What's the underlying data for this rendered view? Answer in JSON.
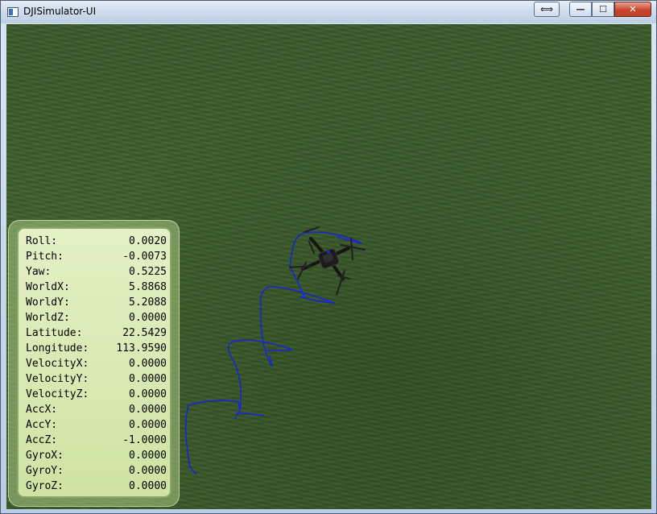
{
  "window": {
    "title": "DJISimulator-UI",
    "buttons": {
      "extra": "⟺",
      "minimize": "—",
      "maximize": "☐",
      "close": "✕"
    }
  },
  "colors": {
    "ground": "#3d5b2d",
    "trajectory": "#1626d6",
    "panel": "#d8eab2"
  },
  "telemetry": [
    {
      "label": "Roll:",
      "value": "0.0020"
    },
    {
      "label": "Pitch:",
      "value": "-0.0073"
    },
    {
      "label": "Yaw:",
      "value": "0.5225"
    },
    {
      "label": "WorldX:",
      "value": "5.8868"
    },
    {
      "label": "WorldY:",
      "value": "5.2088"
    },
    {
      "label": "WorldZ:",
      "value": "0.0000"
    },
    {
      "label": "Latitude:",
      "value": "22.5429"
    },
    {
      "label": "Longitude:",
      "value": "113.9590"
    },
    {
      "label": "VelocityX:",
      "value": "0.0000"
    },
    {
      "label": "VelocityY:",
      "value": "0.0000"
    },
    {
      "label": "VelocityZ:",
      "value": "0.0000"
    },
    {
      "label": "AccX:",
      "value": "0.0000"
    },
    {
      "label": "AccY:",
      "value": "0.0000"
    },
    {
      "label": "AccZ:",
      "value": "-1.0000"
    },
    {
      "label": "GyroX:",
      "value": "0.0000"
    },
    {
      "label": "GyroY:",
      "value": "0.0000"
    },
    {
      "label": "GyroZ:",
      "value": "0.0000"
    }
  ]
}
